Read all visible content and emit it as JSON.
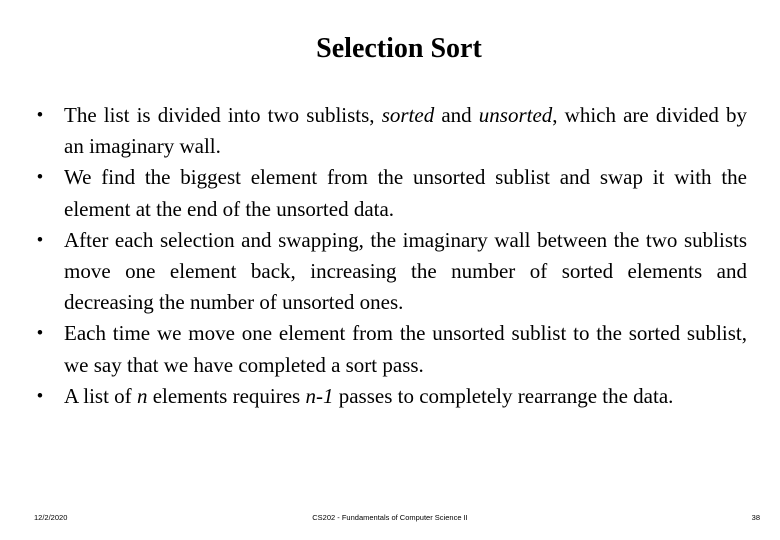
{
  "slide": {
    "title": "Selection Sort",
    "bullets": [
      {
        "parts": [
          "The list is divided into two sublists, ",
          "sorted",
          " and ",
          "unsorted",
          ", which are divided by an imaginary wall."
        ]
      },
      {
        "text": "We find the biggest element from the unsorted sublist and swap it with the element at the end of the unsorted data."
      },
      {
        "text": "After each selection and swapping, the imaginary wall between the two sublists move one element back, increasing the number of sorted elements and decreasing the number of unsorted ones."
      },
      {
        "text": "Each time we move one element from the unsorted sublist to the sorted sublist, we say that we have completed a sort pass."
      },
      {
        "parts": [
          "A list of ",
          "n",
          " elements requires ",
          "n-1",
          " passes to completely rearrange the data."
        ]
      }
    ],
    "bullet_icon": "•"
  },
  "footer": {
    "date": "12/2/2020",
    "course": "CS202 - Fundamentals of Computer Science II",
    "page_number": "38"
  }
}
